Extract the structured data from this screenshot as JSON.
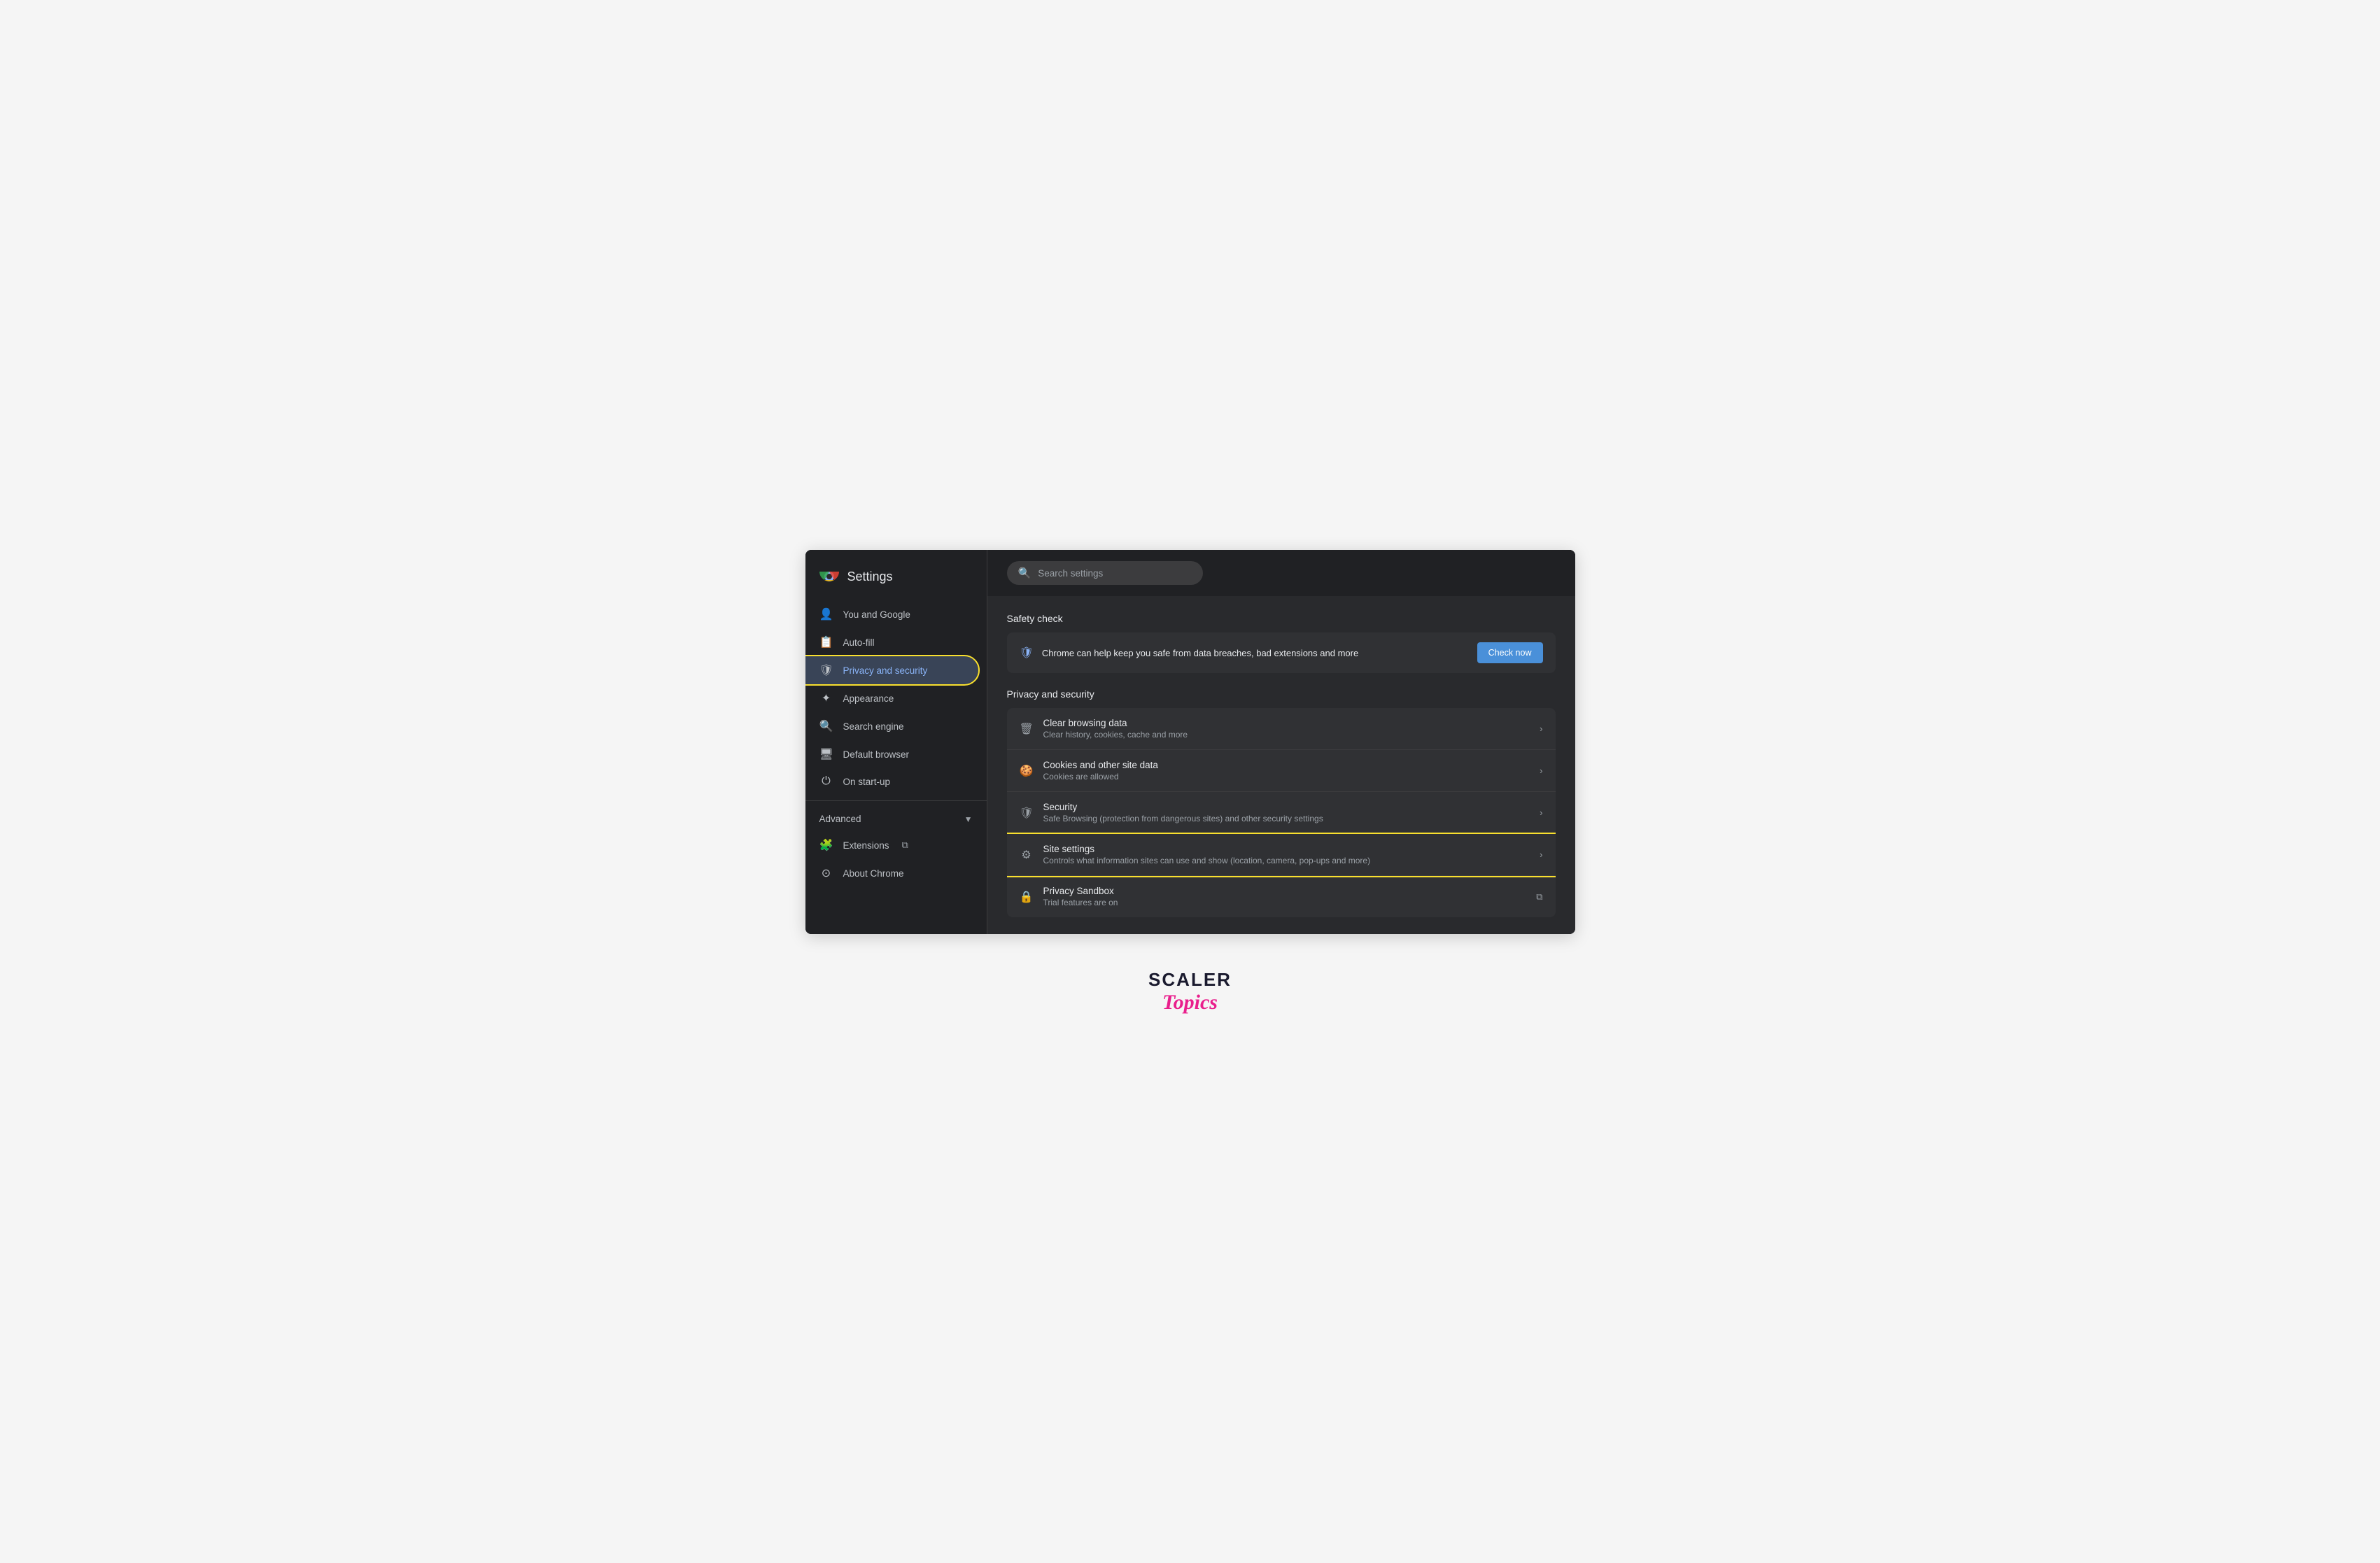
{
  "header": {
    "title": "Settings",
    "search_placeholder": "Search settings"
  },
  "sidebar": {
    "items": [
      {
        "id": "you-and-google",
        "label": "You and Google",
        "icon": "👤",
        "active": false
      },
      {
        "id": "auto-fill",
        "label": "Auto-fill",
        "icon": "📋",
        "active": false
      },
      {
        "id": "privacy-and-security",
        "label": "Privacy and security",
        "icon": "🛡",
        "active": true,
        "highlighted": true
      },
      {
        "id": "appearance",
        "label": "Appearance",
        "icon": "⚙",
        "active": false
      },
      {
        "id": "search-engine",
        "label": "Search engine",
        "icon": "🔍",
        "active": false
      },
      {
        "id": "default-browser",
        "label": "Default browser",
        "icon": "🖥",
        "active": false
      },
      {
        "id": "on-start-up",
        "label": "On start-up",
        "icon": "⏻",
        "active": false
      }
    ],
    "advanced_label": "Advanced",
    "sub_items": [
      {
        "id": "extensions",
        "label": "Extensions",
        "icon": "🧩",
        "has_link": true
      },
      {
        "id": "about-chrome",
        "label": "About Chrome",
        "icon": "⊙",
        "active": false
      }
    ]
  },
  "main": {
    "safety_check": {
      "section_title": "Safety check",
      "description": "Chrome can help keep you safe from data breaches, bad extensions and more",
      "button_label": "Check now"
    },
    "privacy_section": {
      "section_title": "Privacy and security",
      "items": [
        {
          "id": "clear-browsing-data",
          "title": "Clear browsing data",
          "subtitle": "Clear history, cookies, cache and more",
          "icon": "🗑",
          "has_arrow": true,
          "highlighted": false
        },
        {
          "id": "cookies-and-site-data",
          "title": "Cookies and other site data",
          "subtitle": "Cookies are allowed",
          "icon": "🍪",
          "has_arrow": true,
          "highlighted": false
        },
        {
          "id": "security",
          "title": "Security",
          "subtitle": "Safe Browsing (protection from dangerous sites) and other security settings",
          "icon": "🛡",
          "has_arrow": true,
          "highlighted": false
        },
        {
          "id": "site-settings",
          "title": "Site settings",
          "subtitle": "Controls what information sites can use and show (location, camera, pop-ups and more)",
          "icon": "⚙",
          "has_arrow": true,
          "highlighted": true
        },
        {
          "id": "privacy-sandbox",
          "title": "Privacy Sandbox",
          "subtitle": "Trial features are on",
          "icon": "🔒",
          "has_external": true,
          "highlighted": false
        }
      ]
    }
  },
  "scaler": {
    "text": "SCALER",
    "topics": "Topics"
  }
}
